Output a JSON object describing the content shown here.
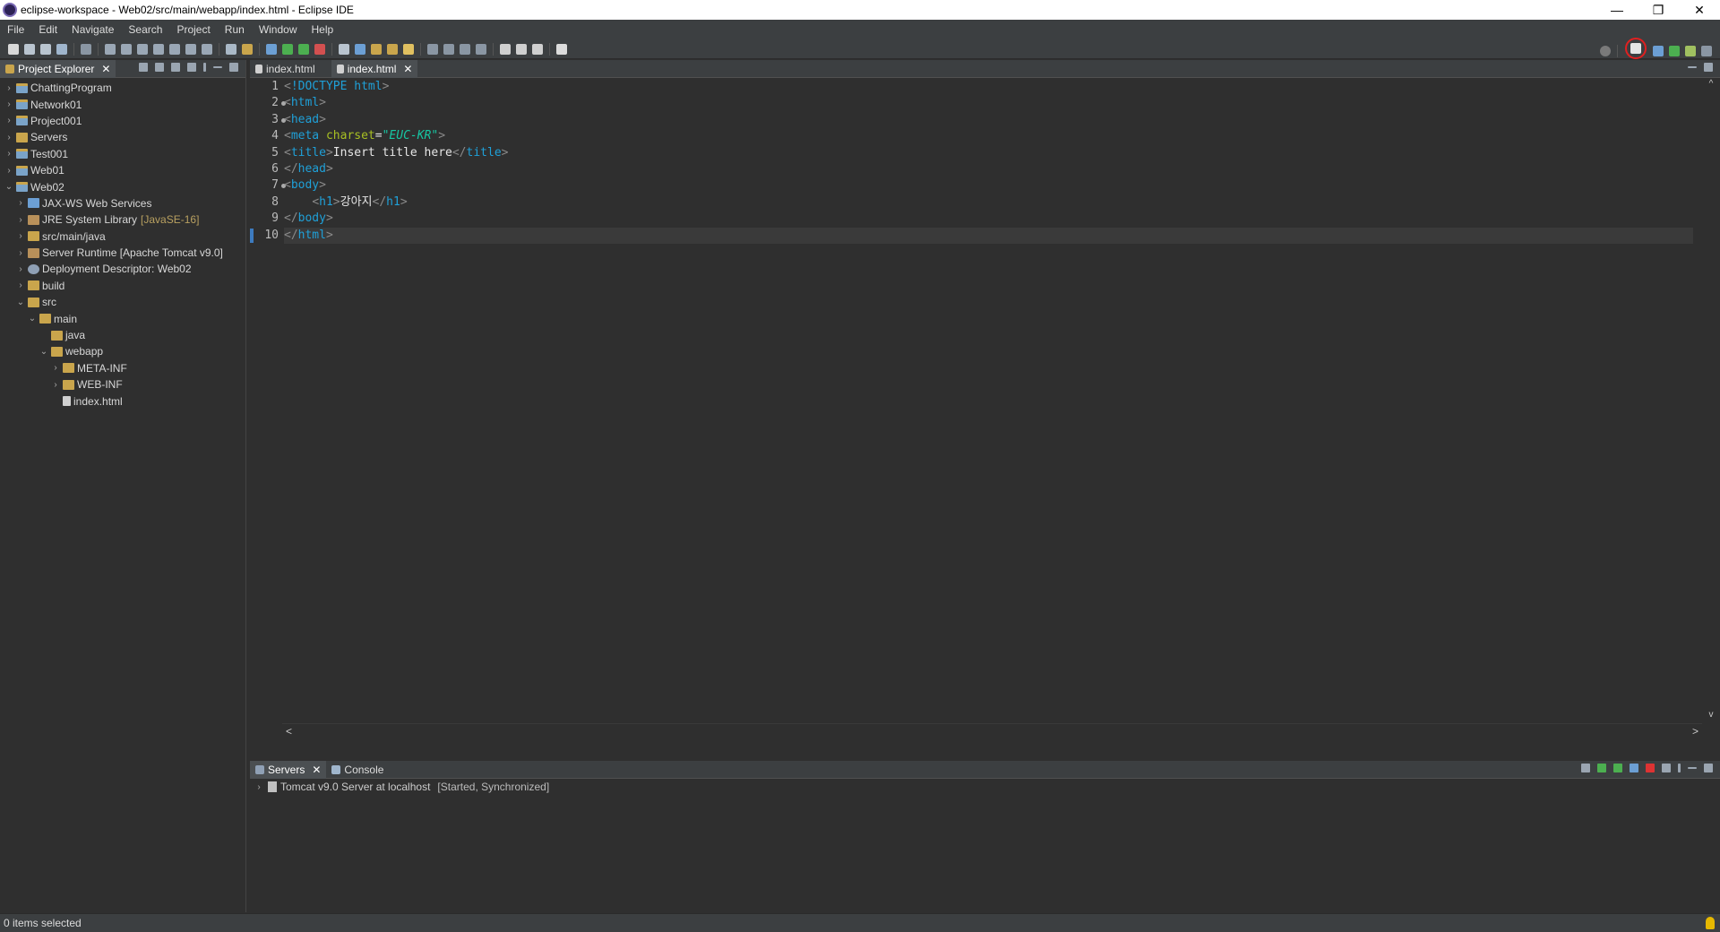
{
  "window": {
    "title": "eclipse-workspace - Web02/src/main/webapp/index.html - Eclipse IDE",
    "controls": {
      "minimize": "—",
      "restore": "❐",
      "close": "✕"
    }
  },
  "menu": [
    "File",
    "Edit",
    "Navigate",
    "Search",
    "Project",
    "Run",
    "Window",
    "Help"
  ],
  "explorer": {
    "tab_label": "Project Explorer",
    "close": "✕",
    "items": [
      {
        "label": "ChattingProgram",
        "icon": "project-icon",
        "level": 0,
        "expander": "›"
      },
      {
        "label": "Network01",
        "icon": "project-icon",
        "level": 0,
        "expander": "›"
      },
      {
        "label": "Project001",
        "icon": "project-icon",
        "level": 0,
        "expander": "›"
      },
      {
        "label": "Servers",
        "icon": "folder-icon",
        "level": 0,
        "expander": "›"
      },
      {
        "label": "Test001",
        "icon": "project-icon",
        "level": 0,
        "expander": "›"
      },
      {
        "label": "Web01",
        "icon": "project-icon",
        "level": 0,
        "expander": "›"
      },
      {
        "label": "Web02",
        "icon": "project-icon",
        "level": 0,
        "expander": "⌄"
      },
      {
        "label": "JAX-WS Web Services",
        "icon": "webservice-icon",
        "level": 1,
        "expander": "›"
      },
      {
        "label": "JRE System Library",
        "decoration": "[JavaSE-16]",
        "icon": "library-icon",
        "level": 1,
        "expander": "›"
      },
      {
        "label": "src/main/java",
        "icon": "folder-icon",
        "level": 1,
        "expander": "›"
      },
      {
        "label": "Server Runtime [Apache Tomcat v9.0]",
        "icon": "library-icon",
        "level": 1,
        "expander": "›"
      },
      {
        "label": "Deployment Descriptor: Web02",
        "icon": "gear-icon",
        "level": 1,
        "expander": "›"
      },
      {
        "label": "build",
        "icon": "folder-icon",
        "level": 1,
        "expander": "›"
      },
      {
        "label": "src",
        "icon": "folder-icon",
        "level": 1,
        "expander": "⌄"
      },
      {
        "label": "main",
        "icon": "folder-icon",
        "level": 2,
        "expander": "⌄"
      },
      {
        "label": "java",
        "icon": "folder-icon",
        "level": 3,
        "expander": ""
      },
      {
        "label": "webapp",
        "icon": "folder-icon",
        "level": 3,
        "expander": "⌄"
      },
      {
        "label": "META-INF",
        "icon": "folder-icon",
        "level": 4,
        "expander": "›"
      },
      {
        "label": "WEB-INF",
        "icon": "folder-icon",
        "level": 4,
        "expander": "›"
      },
      {
        "label": "index.html",
        "icon": "file-icon",
        "level": 4,
        "expander": ""
      }
    ]
  },
  "editor": {
    "tabs": [
      {
        "label": "index.html",
        "active": false
      },
      {
        "label": "index.html",
        "active": true,
        "close": "✕"
      }
    ],
    "line_numbers": [
      "1",
      "2",
      "3",
      "4",
      "5",
      "6",
      "7",
      "8",
      "9",
      "10"
    ],
    "fold_markers": [
      false,
      true,
      true,
      false,
      false,
      false,
      true,
      false,
      false,
      false
    ],
    "lines": [
      [
        {
          "t": "<",
          "c": "bracket"
        },
        {
          "t": "!DOCTYPE html",
          "c": "doctype"
        },
        {
          "t": ">",
          "c": "bracket"
        }
      ],
      [
        {
          "t": "<",
          "c": "bracket"
        },
        {
          "t": "html",
          "c": "tag"
        },
        {
          "t": ">",
          "c": "bracket"
        }
      ],
      [
        {
          "t": "<",
          "c": "bracket"
        },
        {
          "t": "head",
          "c": "tag"
        },
        {
          "t": ">",
          "c": "bracket"
        }
      ],
      [
        {
          "t": "<",
          "c": "bracket"
        },
        {
          "t": "meta",
          "c": "tag"
        },
        {
          "t": " charset",
          "c": "attr"
        },
        {
          "t": "=",
          "c": "txt"
        },
        {
          "t": "\"EUC-KR\"",
          "c": "str"
        },
        {
          "t": ">",
          "c": "bracket"
        }
      ],
      [
        {
          "t": "<",
          "c": "bracket"
        },
        {
          "t": "title",
          "c": "tag"
        },
        {
          "t": ">",
          "c": "bracket"
        },
        {
          "t": "Insert title here",
          "c": "txt"
        },
        {
          "t": "</",
          "c": "bracket"
        },
        {
          "t": "title",
          "c": "tag"
        },
        {
          "t": ">",
          "c": "bracket"
        }
      ],
      [
        {
          "t": "</",
          "c": "bracket"
        },
        {
          "t": "head",
          "c": "tag"
        },
        {
          "t": ">",
          "c": "bracket"
        }
      ],
      [
        {
          "t": "<",
          "c": "bracket"
        },
        {
          "t": "body",
          "c": "tag"
        },
        {
          "t": ">",
          "c": "bracket"
        }
      ],
      [
        {
          "t": "    ",
          "c": "txt"
        },
        {
          "t": "<",
          "c": "bracket"
        },
        {
          "t": "h1",
          "c": "tag"
        },
        {
          "t": ">",
          "c": "bracket"
        },
        {
          "t": "강아지",
          "c": "txt"
        },
        {
          "t": "</",
          "c": "bracket"
        },
        {
          "t": "h1",
          "c": "tag"
        },
        {
          "t": ">",
          "c": "bracket"
        }
      ],
      [
        {
          "t": "</",
          "c": "bracket"
        },
        {
          "t": "body",
          "c": "tag"
        },
        {
          "t": ">",
          "c": "bracket"
        }
      ],
      [
        {
          "t": "</",
          "c": "bracket"
        },
        {
          "t": "html",
          "c": "tag"
        },
        {
          "t": ">",
          "c": "bracket"
        }
      ]
    ],
    "current_line": 10,
    "scroll": {
      "left": "<",
      "right": ">",
      "up": "^",
      "down": "v"
    }
  },
  "bottom": {
    "tabs": [
      {
        "label": "Servers",
        "active": true,
        "close": "✕"
      },
      {
        "label": "Console",
        "active": false
      }
    ],
    "server_name": "Tomcat v9.0 Server at localhost",
    "server_state": "[Started, Synchronized]",
    "expander": "›"
  },
  "status": {
    "text": "0 items selected"
  },
  "colors": {
    "tag": "#1fa0d8",
    "attribute": "#a8c023",
    "string": "#17c6a3",
    "highlight_ring": "#e02020"
  }
}
